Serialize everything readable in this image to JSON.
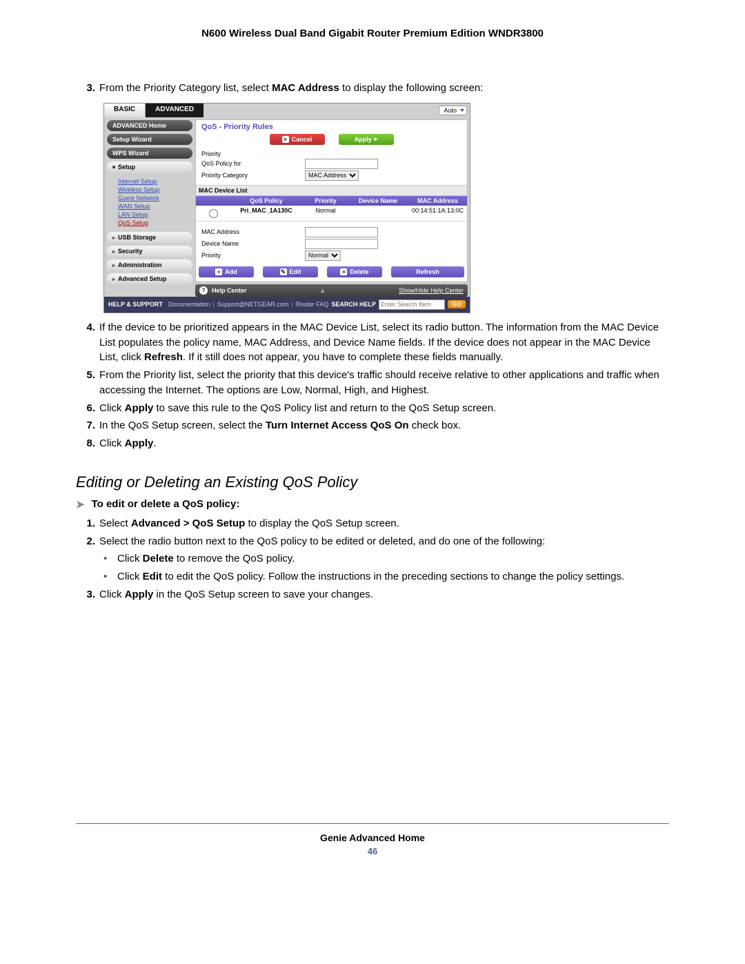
{
  "doc": {
    "header": "N600 Wireless Dual Band Gigabit Router Premium Edition WNDR3800",
    "footer_title": "Genie Advanced Home",
    "page_number": "46"
  },
  "steps_top": {
    "n3": {
      "num": "3.",
      "pre": "From the Priority Category list, select ",
      "bold": "MAC Address",
      "post": " to display the following screen:"
    },
    "n4": {
      "num": "4.",
      "text": "If the device to be prioritized appears in the MAC Device List, select its radio button. The information from the MAC Device List populates the policy name, MAC Address, and Device Name fields. If the device does not appear in the MAC Device List, click ",
      "bold": "Refresh",
      "post": ". If it still does not appear, you have to complete these fields manually."
    },
    "n5": {
      "num": "5.",
      "text": "From the Priority list, select the priority that this device's traffic should receive relative to other applications and traffic when accessing the Internet. The options are Low, Normal, High, and Highest."
    },
    "n6": {
      "num": "6.",
      "pre": "Click ",
      "bold": "Apply",
      "post": " to save this rule to the QoS Policy list and return to the QoS Setup screen."
    },
    "n7": {
      "num": "7.",
      "pre": "In the QoS Setup screen, select the ",
      "bold": "Turn Internet Access QoS On",
      "post": " check box."
    },
    "n8": {
      "num": "8.",
      "pre": "Click ",
      "bold": "Apply",
      "post": "."
    }
  },
  "section2": {
    "title": "Editing or Deleting an Existing QoS Policy",
    "lead": "To edit or delete a QoS policy:",
    "s1": {
      "num": "1.",
      "pre": "Select ",
      "bold": "Advanced > QoS Setup",
      "post": " to display the QoS Setup screen."
    },
    "s2": {
      "num": "2.",
      "text": "Select the radio button next to the QoS policy to be edited or deleted, and do one of the following:"
    },
    "b1": {
      "pre": "Click ",
      "bold": "Delete",
      "post": " to remove the QoS policy."
    },
    "b2": {
      "pre": "Click ",
      "bold": "Edit",
      "post": " to edit the QoS policy. Follow the instructions in the preceding sections to change the policy settings."
    },
    "s3": {
      "num": "3.",
      "pre": "Click ",
      "bold": "Apply",
      "post": " in the QoS Setup screen to save your changes."
    }
  },
  "shot": {
    "tabs": {
      "basic": "BASIC",
      "advanced": "ADVANCED",
      "auto": "Auto"
    },
    "sidebar": {
      "home": "ADVANCED Home",
      "setup_wizard": "Setup Wizard",
      "wps_wizard": "WPS Wizard",
      "setup": "Setup",
      "links": {
        "internet": "Internet Setup",
        "wireless": "Wireless Setup",
        "guest": "Guest Network",
        "wan": "WAN Setup",
        "lan": "LAN Setup",
        "qos": "QoS Setup"
      },
      "usb": "USB Storage",
      "security": "Security",
      "admin": "Administration",
      "advsetup": "Advanced Setup"
    },
    "main": {
      "title": "QoS - Priority Rules",
      "cancel": "Cancel",
      "apply": "Apply",
      "priority_label": "Priority",
      "qos_policy_for": "QoS Policy for",
      "priority_category": "Priority Category",
      "priority_category_value": "MAC Address",
      "mac_list": "MAC Device List",
      "th_policy": "QoS Policy",
      "th_priority": "Priority",
      "th_devname": "Device Name",
      "th_mac": "MAC Address",
      "row_policy": "Pri_MAC_1A130C",
      "row_priority": "Normal",
      "row_devname": "",
      "row_mac": "00:14:51:1A:13:0C",
      "mac_address_label": "MAC Address",
      "device_name_label": "Device Name",
      "priority_select": "Normal",
      "add": "Add",
      "edit": "Edit",
      "delete": "Delete",
      "refresh": "Refresh"
    },
    "helpbar": {
      "title": "Help Center",
      "showhide": "Show/Hide Help Center"
    },
    "support": {
      "lead": "HELP & SUPPORT",
      "doc": "Documentation",
      "sup": "Support@NETGEAR.com",
      "faq": "Router FAQ",
      "search_label": "SEARCH HELP",
      "placeholder": "Enter Search Item",
      "go": "GO"
    }
  }
}
